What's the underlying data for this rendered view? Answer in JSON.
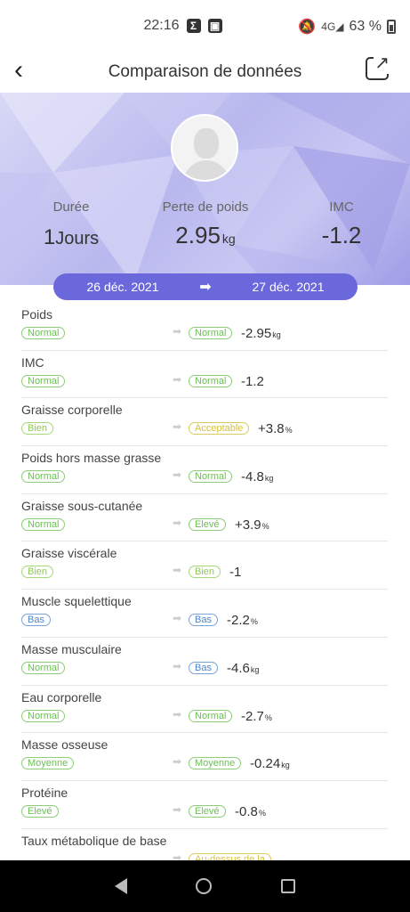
{
  "status": {
    "time": "22:16",
    "battery": "63 %",
    "icon_sigma": "Σ",
    "network_label": "4G"
  },
  "app_bar": {
    "title": "Comparaison de données"
  },
  "summary": {
    "duration_label": "Durée",
    "duration_value": "1",
    "duration_unit": "Jours",
    "loss_label": "Perte de poids",
    "loss_value": "2.95",
    "loss_unit": "kg",
    "bmi_label": "IMC",
    "bmi_value": "-1.2"
  },
  "dates": {
    "from": "26 déc. 2021",
    "to": "27 déc. 2021"
  },
  "rows": [
    {
      "name": "Poids",
      "before": "Normal",
      "after": "Normal",
      "delta": "-2.95",
      "unit": "kg"
    },
    {
      "name": "IMC",
      "before": "Normal",
      "after": "Normal",
      "delta": "-1.2",
      "unit": ""
    },
    {
      "name": "Graisse corporelle",
      "before": "Bien",
      "after": "Acceptable",
      "delta": "+3.8",
      "unit": "%"
    },
    {
      "name": "Poids hors masse grasse",
      "before": "Normal",
      "after": "Normal",
      "delta": "-4.8",
      "unit": "kg"
    },
    {
      "name": "Graisse sous-cutanée",
      "before": "Normal",
      "after": "Elevé",
      "delta": "+3.9",
      "unit": "%"
    },
    {
      "name": "Graisse viscérale",
      "before": "Bien",
      "after": "Bien",
      "delta": "-1",
      "unit": ""
    },
    {
      "name": "Muscle squelettique",
      "before": "Bas",
      "after": "Bas",
      "delta": "-2.2",
      "unit": "%"
    },
    {
      "name": "Masse musculaire",
      "before": "Normal",
      "after": "Bas",
      "delta": "-4.6",
      "unit": "kg"
    },
    {
      "name": "Eau corporelle",
      "before": "Normal",
      "after": "Normal",
      "delta": "-2.7",
      "unit": "%"
    },
    {
      "name": "Masse osseuse",
      "before": "Moyenne",
      "after": "Moyenne",
      "delta": "-0.24",
      "unit": "kg"
    },
    {
      "name": "Protéine",
      "before": "Elevé",
      "after": "Elevé",
      "delta": "-0.8",
      "unit": "%"
    },
    {
      "name": "Taux métabolique de base",
      "before": "",
      "after": "Au-dessus de la",
      "delta": "",
      "unit": ""
    }
  ],
  "colors": {
    "accent": "#6b68dc",
    "normal": "#6bbf54",
    "bien": "#8fca54",
    "warn": "#d6c33c",
    "low": "#4c86c9"
  }
}
